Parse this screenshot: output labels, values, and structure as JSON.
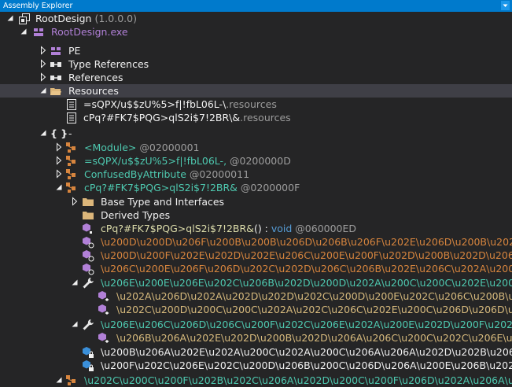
{
  "panel": {
    "title": "Assembly Explorer"
  },
  "tree": {
    "root_name": "RootDesign",
    "root_version": "(1.0.0.0)",
    "module": "RootDesign.exe",
    "pe": "PE",
    "type_refs": "Type References",
    "refs": "References",
    "resources": "Resources",
    "res1_name": "=sQPX/u$$zU%5>f|!fbL06L-\\",
    "res1_ext": ".resources",
    "res2_name": "cPq?#FK7$PQG>qlS2i$7!2BR\\&",
    "res2_ext": ".resources",
    "ns": "{ }",
    "ns_dash": "-",
    "t1_name": "<Module>",
    "t1_tok": "@02000001",
    "t2_name": "=sQPX/u$$zU%5>f|!fbL06L-,",
    "t2_tok": "@0200000D",
    "t3_name": "ConfusedByAttribute",
    "t3_tok": "@02000011",
    "t4_name": "cPq?#FK7$PQG>qlS2i$7!2BR&",
    "t4_tok": "@0200000F",
    "base_types": "Base Type and Interfaces",
    "derived": "Derived Types",
    "m1_name": "cPq?#FK7$PQG>qlS2i$7!2BR&",
    "m1_sig": "() : ",
    "m1_void": "void",
    "m1_tok": " @060000ED",
    "l1": "\\u200D\\u200D\\u206F\\u200B\\u200B\\u206D\\u206B\\u206F\\u202E\\u206D\\u200B\\u202B\\u206E",
    "l2": "\\u200D\\u200F\\u202E\\u202D\\u202E\\u206C\\u200E\\u200F\\u202D\\u200B\\u202D\\u206F\\u206E",
    "l3": "\\u206C\\u200E\\u206F\\u206D\\u202C\\u202D\\u206C\\u206B\\u202E\\u206C\\u202A\\u200B\\u202C",
    "l4": "\\u206E\\u200E\\u206E\\u202C\\u206B\\u202D\\u200D\\u202A\\u200C\\u200C\\u202E\\u200B\\u202E",
    "l5": "\\u202A\\u206D\\u202A\\u202D\\u202D\\u202C\\u200D\\u200E\\u202C\\u206C\\u200B\\u200E",
    "l6": "\\u202C\\u200D\\u200C\\u200C\\u202A\\u202C\\u206C\\u202E\\u200C\\u206D\\u206D\\u202D",
    "l7": "\\u206E\\u206C\\u206D\\u206C\\u200F\\u202C\\u206E\\u202A\\u200E\\u202D\\u200F\\u202E\\u206E",
    "l8": "\\u206B\\u206A\\u202E\\u202D\\u200B\\u202D\\u206A\\u206C\\u200C\\u202C\\u206E\\u202C\\u206A",
    "l9": "\\u200B\\u206A\\u202E\\u202A\\u200C\\u202A\\u200C\\u206A\\u206A\\u202D\\u202B\\u206E\\u202A",
    "l10": "\\u200F\\u202C\\u206E\\u202C\\u200D\\u206B\\u200C\\u206D\\u206A\\u200E\\u206B\\u202A\\u206F",
    "l11": "\\u202C\\u200C\\u200F\\u202B\\u202C\\u206A\\u202D\\u200C\\u200F\\u206D\\u202A\\u206A\\u206F"
  }
}
